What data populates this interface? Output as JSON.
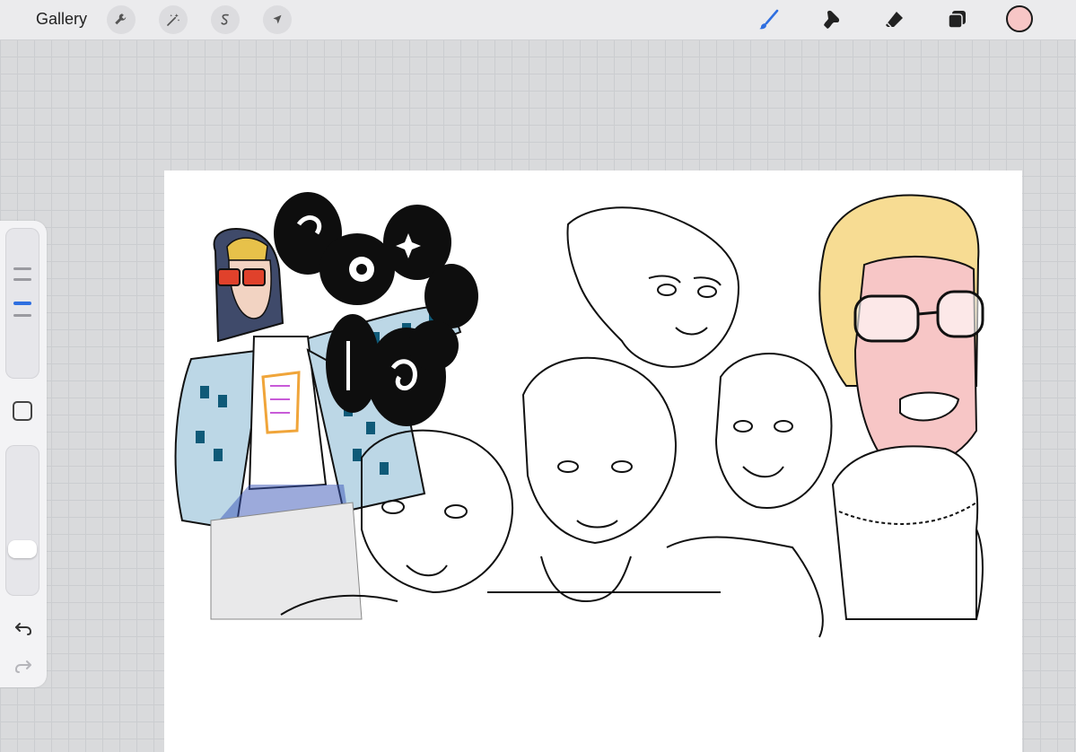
{
  "toolbar": {
    "gallery_label": "Gallery",
    "left_tools": [
      "wrench-icon",
      "magic-wand-icon",
      "selection-icon",
      "transform-arrow-icon"
    ],
    "right_tools": [
      "brush-icon",
      "smudge-icon",
      "eraser-icon",
      "layers-icon"
    ],
    "active_tool": "brush",
    "current_color": "#f7c6c6"
  },
  "sidebar": {
    "brush_size_level": 0.25,
    "opacity_level": 0.15
  },
  "colors": {
    "accent": "#2f6fe0",
    "canvas_bg": "#ffffff"
  }
}
